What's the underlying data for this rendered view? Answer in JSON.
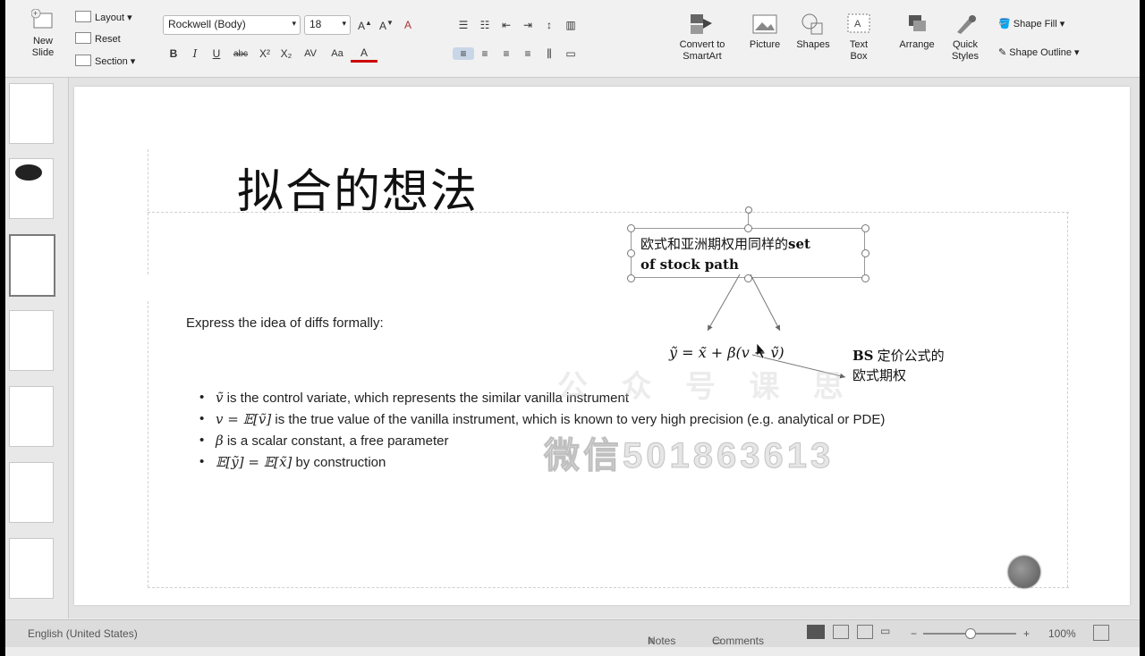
{
  "ribbon": {
    "new_slide": "New\nSlide",
    "layout": "Layout",
    "reset": "Reset",
    "section": "Section",
    "font_name": "Rockwell (Body)",
    "font_size": "18",
    "bold": "B",
    "italic": "I",
    "underline": "U",
    "strike": "abc",
    "superscript": "X²",
    "subscript": "X₂",
    "spacing": "AV",
    "convert": "Convert to\nSmartArt",
    "picture": "Picture",
    "shapes": "Shapes",
    "textbox": "Text\nBox",
    "arrange": "Arrange",
    "quick_styles": "Quick\nStyles",
    "shape_fill": "Shape Fill",
    "shape_outline": "Shape Outline"
  },
  "slide": {
    "title": "拟合的想法",
    "intro": "Express the idea of diffs formally:",
    "callout_cn": "欧式和亚洲期权用同样的",
    "callout_set": "set",
    "callout_path": "of stock path",
    "formula": "ỹ = x̃ + β(v − ṽ)",
    "bs_bold": "BS",
    "bs_line1": " 定价公式的",
    "bs_line2": "欧式期权",
    "bullets": [
      {
        "math": "ṽ",
        "text": " is the control variate, which represents the similar vanilla instrument"
      },
      {
        "math": "v = 𝔼[ṽ]",
        "text": " is the true value of the vanilla instrument, which is known to very high precision (e.g. analytical or PDE)"
      },
      {
        "math": "β",
        "text": " is a scalar constant, a free parameter"
      },
      {
        "math": "𝔼[ỹ] = 𝔼[x̃]",
        "text": " by construction"
      }
    ],
    "watermark": "微信501863613",
    "watermark_top": "公 众 号 课 思"
  },
  "status": {
    "language": "English (United States)",
    "notes": "Notes",
    "comments": "Comments",
    "zoom": "100%"
  }
}
